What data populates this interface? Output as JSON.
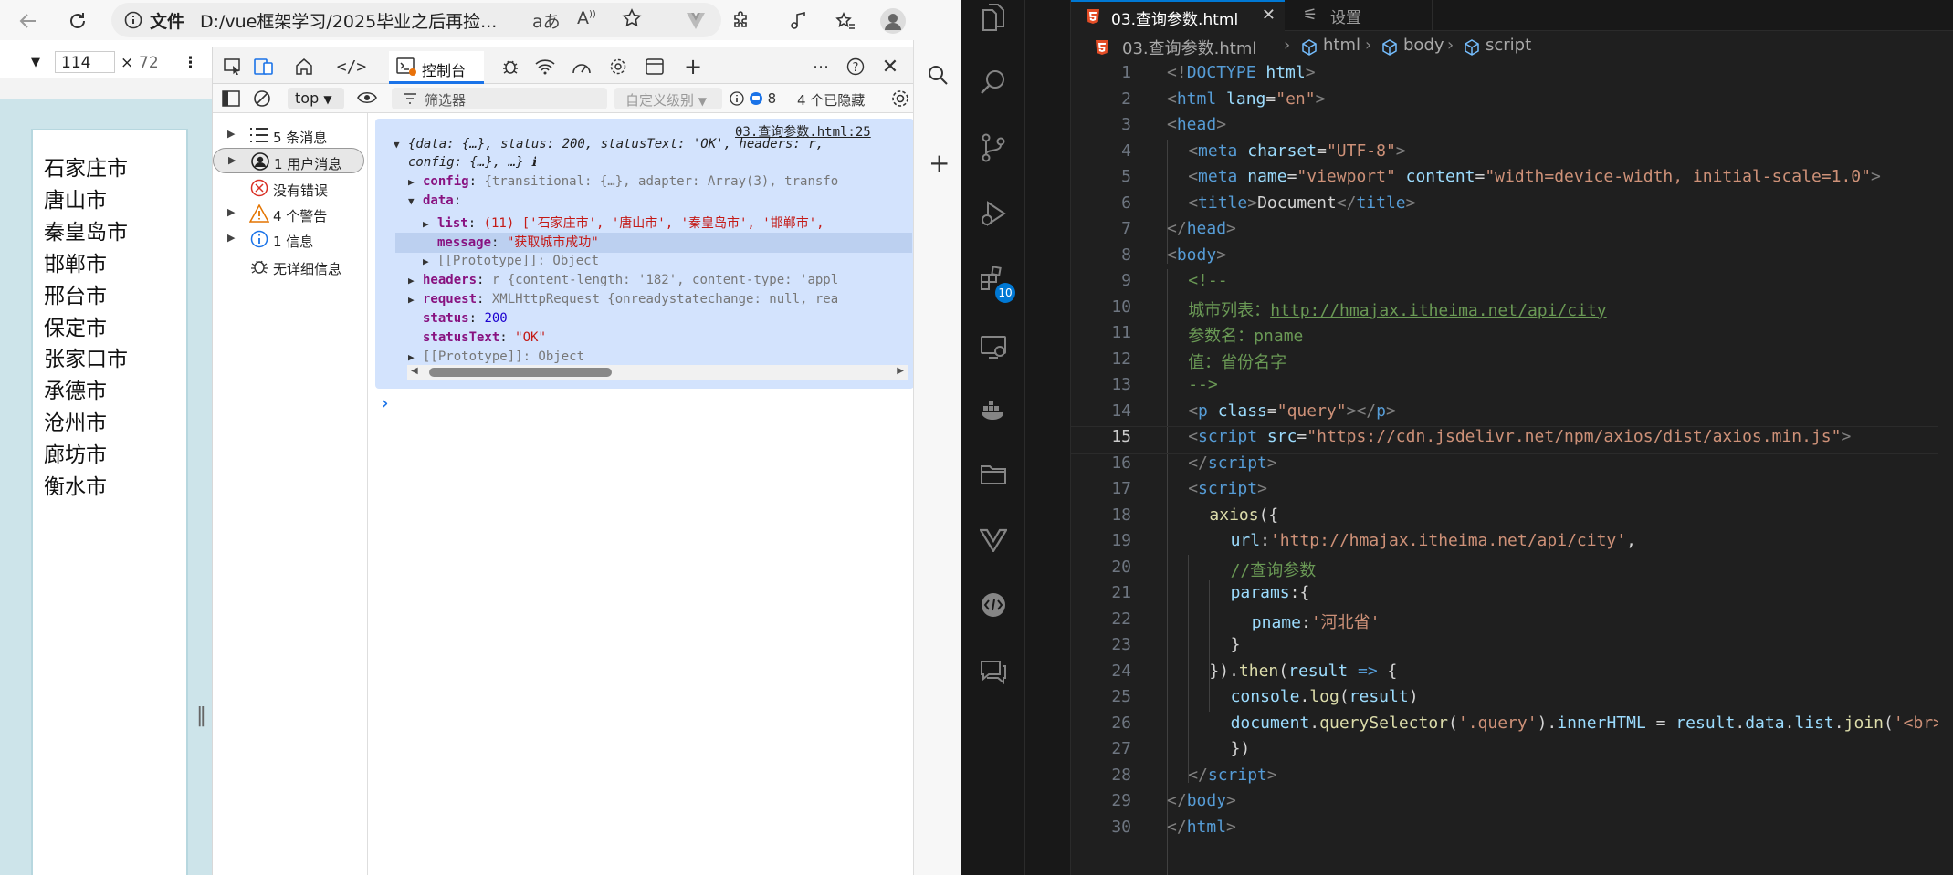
{
  "browser": {
    "address": {
      "scheme_label": "文件",
      "url": "D:/vue框架学习/2025毕业之后再捡..."
    },
    "device": {
      "width": "114",
      "x": "×",
      "height": "72"
    },
    "page_cities": [
      "石家庄市",
      "唐山市",
      "秦皇岛市",
      "邯郸市",
      "邢台市",
      "保定市",
      "张家口市",
      "承德市",
      "沧州市",
      "廊坊市",
      "衡水市"
    ]
  },
  "devtools": {
    "console_tab_label": "控制台",
    "context": "top",
    "filter_placeholder": "筛选器",
    "levels": "自定义级别",
    "issue_count": "8",
    "hidden_label": "4 个已隐藏",
    "sidebar": [
      {
        "label": "5 条消息",
        "icon": "list-icon"
      },
      {
        "label": "1 用户消息",
        "icon": "user-icon"
      },
      {
        "label": "没有错误",
        "icon": "error-icon"
      },
      {
        "label": "4 个警告",
        "icon": "warning-icon"
      },
      {
        "label": "1 信息",
        "icon": "info-icon"
      },
      {
        "label": "无详细信息",
        "icon": "bug-icon"
      }
    ],
    "log": {
      "source": "03.查询参数.html:25",
      "summary_a": "{data: {…}, status: 200, statusText: 'OK', headers: r,",
      "summary_b": "config: {…}, …}",
      "config_key": "config",
      "config_val": "{transitional: {…}, adapter: Array(3), transfo",
      "data_key": "data",
      "list_key": "list",
      "list_val": "(11) ['石家庄市', '唐山市', '秦皇岛市', '邯郸市',",
      "message_key": "message",
      "message_val": "\"获取城市成功\"",
      "proto1": "[[Prototype]]: Object",
      "headers_key": "headers",
      "headers_val": "r {content-length: '182', content-type: 'appl",
      "request_key": "request",
      "request_val": "XMLHttpRequest {onreadystatechange: null, rea",
      "status_key": "status",
      "status_val": "200",
      "statusText_key": "statusText",
      "statusText_val": "\"OK\"",
      "proto2": "[[Prototype]]: Object"
    }
  },
  "vscode": {
    "tab_active": "03.查询参数.html",
    "tab_settings": "设置",
    "extensions_badge": "10",
    "breadcrumb": [
      "03.查询参数.html",
      "html",
      "body",
      "script"
    ],
    "current_line": "15",
    "lines": [
      "1",
      "2",
      "3",
      "4",
      "5",
      "6",
      "7",
      "8",
      "9",
      "10",
      "11",
      "12",
      "13",
      "14",
      "15",
      "16",
      "17",
      "18",
      "19",
      "20",
      "21",
      "22",
      "23",
      "24",
      "25",
      "26",
      "27",
      "28",
      "29",
      "30"
    ],
    "code": {
      "l1": [
        "<!",
        "DOCTYPE",
        " html",
        ">"
      ],
      "l2": [
        "<",
        "html",
        " lang",
        "=",
        "\"en\"",
        ">"
      ],
      "l3": [
        "<",
        "head",
        ">"
      ],
      "l4": [
        "<",
        "meta",
        " charset",
        "=",
        "\"UTF-8\"",
        ">"
      ],
      "l5": [
        "<",
        "meta",
        " name",
        "=",
        "\"viewport\"",
        " content",
        "=",
        "\"width=device-width, initial-scale=1.0\"",
        ">"
      ],
      "l6": [
        "<",
        "title",
        ">",
        "Document",
        "</",
        "title",
        ">"
      ],
      "l7": [
        "</",
        "head",
        ">"
      ],
      "l8": [
        "<",
        "body",
        ">"
      ],
      "l9": "<!--",
      "l10a": "城市列表：",
      "l10b": "http://hmajax.itheima.net/api/city",
      "l11": "参数名：pname",
      "l12": "值：省份名字",
      "l13": "-->",
      "l14": [
        "<",
        "p",
        " class",
        "=",
        "\"query\"",
        "></",
        "p",
        ">"
      ],
      "l15": [
        "<",
        "script",
        " src",
        "=",
        "\"",
        "https://cdn.jsdelivr.net/npm/axios/dist/axios.min.js",
        "\"",
        ">"
      ],
      "l16": [
        "</",
        "script",
        ">"
      ],
      "l17": [
        "<",
        "script",
        ">"
      ],
      "l18": [
        "axios",
        "({"
      ],
      "l19": [
        "url",
        ":",
        "'",
        "http://hmajax.itheima.net/api/city",
        "'",
        ","
      ],
      "l20": "//查询参数",
      "l21": [
        "params",
        ":{"
      ],
      "l22": [
        "pname",
        ":",
        "'河北省'"
      ],
      "l23": "}",
      "l24": [
        "}).",
        "then",
        "(",
        "result",
        " => ",
        "{"
      ],
      "l25": [
        "console",
        ".",
        "log",
        "(",
        "result",
        ")"
      ],
      "l26": [
        "document",
        ".",
        "querySelector",
        "(",
        "'.query'",
        ").",
        "innerHTML",
        " = ",
        "result",
        ".",
        "data",
        ".",
        "list",
        ".",
        "join",
        "(",
        "'<br>"
      ],
      "l27": "})",
      "l28": [
        "</",
        "script",
        ">"
      ],
      "l29": [
        "</",
        "body",
        ">"
      ],
      "l30": [
        "</",
        "html",
        ">"
      ]
    }
  }
}
